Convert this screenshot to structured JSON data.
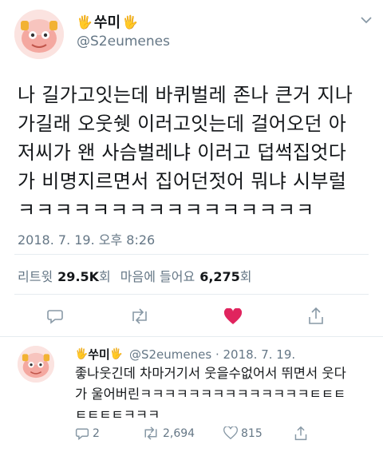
{
  "tweet": {
    "display_name": "쑤미",
    "name_emoji_left": "🖐",
    "name_emoji_right": "🖐",
    "handle": "@S2eumenes",
    "text_lines": [
      "나 길가고잇는데 바퀴벌레 존나 큰거 지나",
      "가길래 오웃쉣 이러고잇는데 걸어오던 아",
      "저씨가 왠 사슴벌레냐 이러고 덥썩집엇다",
      "가 비명지르면서 집어던젓어 뭐냐 시부럴",
      "ㅋㅋㅋㅋㅋㅋㅋㅋㅋㅋㅋㅋㅋㅋㅋㅋ"
    ],
    "timestamp": "2018. 7. 19. 오후 8:26",
    "stats": {
      "retweets_label": "리트윗",
      "retweets_count": "29.5K",
      "retweets_unit": "회",
      "likes_label": "마음에 들어요",
      "likes_count": "6,275",
      "likes_unit": "회"
    },
    "heart_color": "#e0245e"
  },
  "reply": {
    "display_name": "쑤미",
    "handle_date": "@S2eumenes · 2018. 7. 19.",
    "text_lines": [
      "좋나웃긴데 차마거기서 웃을수없어서 뛰면서 웃다",
      "가 울어버린ㅋㅋㅋㅋㅋㅋㅋㅋㅋㅋㅋㅋㅋㅋㅌㅌㅌ",
      "ㅌㅌㅌㅌㅋㅋㅋ"
    ],
    "reply_count": "2",
    "retweet_count": "2,694",
    "like_count": "815"
  },
  "icons": {
    "more": "chevron-down-icon",
    "reply": "reply-icon",
    "retweet": "retweet-icon",
    "like": "heart-icon",
    "share": "share-icon"
  }
}
